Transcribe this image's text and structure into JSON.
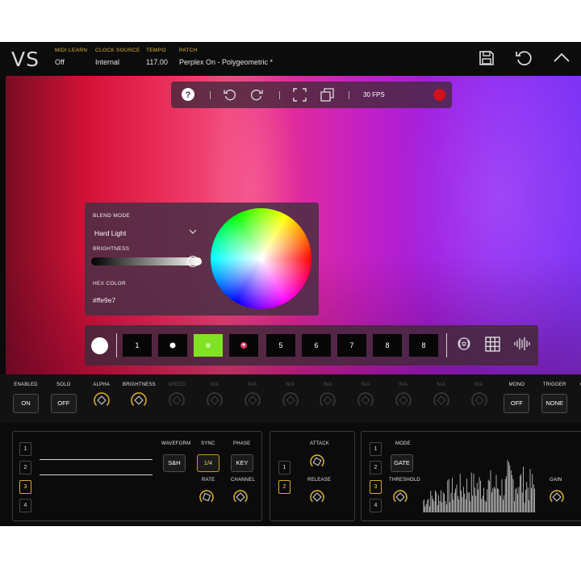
{
  "header": {
    "logo": "VS",
    "fields": [
      {
        "label": "MIDI LEARN",
        "value": "Off"
      },
      {
        "label": "CLOCK SOURCE",
        "value": "Internal"
      },
      {
        "label": "TEMPO",
        "value": "117.00"
      },
      {
        "label": "PATCH",
        "value": "Perplex On - Polygeometric *"
      }
    ],
    "icons": [
      "save-icon",
      "undo-icon",
      "collapse-icon"
    ]
  },
  "toolbar": {
    "icons": [
      "help-icon",
      "undo-icon",
      "redo-icon",
      "fullscreen-icon",
      "duplicate-icon"
    ],
    "fps": "30 FPS",
    "record_color": "#d40f1c"
  },
  "blend_panel": {
    "blend_mode_label": "BLEND MODE",
    "blend_mode_value": "Hard Light",
    "brightness_label": "BRIGHTNESS",
    "brightness_level": 0.93,
    "hex_label": "HEX COLOR",
    "hex_value": "#ffe9e7"
  },
  "slots": {
    "labels": [
      "1",
      "",
      "",
      "",
      "5",
      "6",
      "7",
      "8",
      "8"
    ],
    "active_index": 2,
    "active_color": "#7fe321",
    "right_icons": [
      "broadcast-icon",
      "grid-icon",
      "waveform-icon"
    ]
  },
  "params": [
    {
      "label": "ENABLED",
      "type": "button",
      "value": "ON"
    },
    {
      "label": "SOLO",
      "type": "button",
      "value": "OFF"
    },
    {
      "label": "ALPHA",
      "type": "knob"
    },
    {
      "label": "BRIGHTNESS",
      "type": "knob"
    },
    {
      "label": "SPEED",
      "type": "knob",
      "dim": true
    },
    {
      "label": "N/A",
      "type": "knob",
      "dim": true
    },
    {
      "label": "N/A",
      "type": "knob",
      "dim": true
    },
    {
      "label": "N/A",
      "type": "knob",
      "dim": true
    },
    {
      "label": "N/A",
      "type": "knob",
      "dim": true
    },
    {
      "label": "N/A",
      "type": "knob",
      "dim": true
    },
    {
      "label": "N/A",
      "type": "knob",
      "dim": true
    },
    {
      "label": "N/A",
      "type": "knob",
      "dim": true
    },
    {
      "label": "N/A",
      "type": "knob",
      "dim": true
    },
    {
      "label": "MONO",
      "type": "button",
      "value": "OFF"
    },
    {
      "label": "TRIGGER",
      "type": "button",
      "value": "NONE"
    },
    {
      "label": "CHANNEL",
      "type": "knob"
    }
  ],
  "lfo": {
    "numbers": [
      "1",
      "2",
      "3",
      "4"
    ],
    "selected": "3",
    "waveform_label": "WAVEFORM",
    "waveform_value": "S&H",
    "sync_label": "SYNC",
    "sync_value": "1/4",
    "phase_label": "PHASE",
    "phase_value": "KEY",
    "rate_label": "RATE",
    "channel_label": "CHANNEL"
  },
  "envelope": {
    "numbers": [
      "1",
      "2"
    ],
    "selected": "2",
    "attack_label": "ATTACK",
    "release_label": "RELEASE"
  },
  "gate": {
    "numbers": [
      "1",
      "2",
      "3",
      "4"
    ],
    "selected": "3",
    "mode_label": "MODE",
    "mode_value": "GATE",
    "threshold_label": "THRESHOLD",
    "gain_label": "GAIN"
  },
  "colors": {
    "accent": "#e2b53b",
    "knob_gold": "#d6aa2b"
  }
}
